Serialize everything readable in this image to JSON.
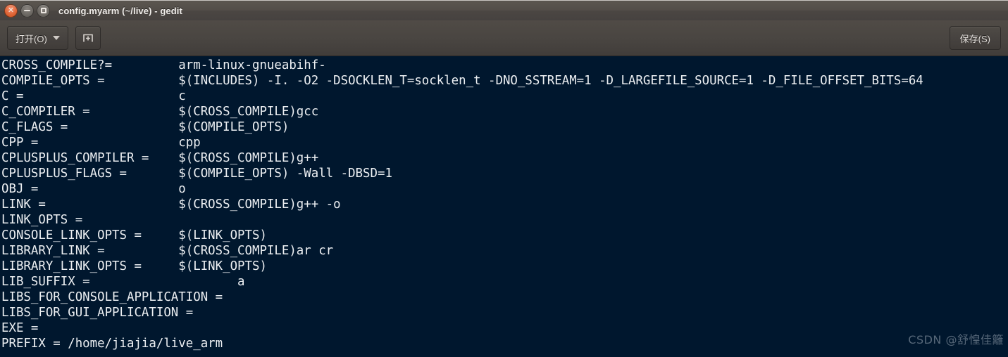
{
  "window": {
    "title": "config.myarm (~/live) - gedit",
    "controls": [
      {
        "name": "close",
        "label": "×"
      },
      {
        "name": "minimize",
        "label": "−"
      },
      {
        "name": "maximize",
        "label": "□"
      }
    ]
  },
  "toolbar": {
    "open_label": "打开(O)",
    "new_tab_icon": "new-document-icon",
    "save_label": "保存(S)"
  },
  "editor": {
    "filename": "config.myarm",
    "background_color": "#00172e",
    "text_color": "#eceff2",
    "cursor_line": 20,
    "lines": [
      "CROSS_COMPILE?=         arm-linux-gnueabihf-",
      "COMPILE_OPTS =          $(INCLUDES) -I. -O2 -DSOCKLEN_T=socklen_t -DNO_SSTREAM=1 -D_LARGEFILE_SOURCE=1 -D_FILE_OFFSET_BITS=64",
      "C =                     c",
      "C_COMPILER =            $(CROSS_COMPILE)gcc",
      "C_FLAGS =               $(COMPILE_OPTS)",
      "CPP =                   cpp",
      "CPLUSPLUS_COMPILER =    $(CROSS_COMPILE)g++",
      "CPLUSPLUS_FLAGS =       $(COMPILE_OPTS) -Wall -DBSD=1",
      "OBJ =                   o",
      "LINK =                  $(CROSS_COMPILE)g++ -o",
      "LINK_OPTS =",
      "CONSOLE_LINK_OPTS =     $(LINK_OPTS)",
      "LIBRARY_LINK =          $(CROSS_COMPILE)ar cr",
      "LIBRARY_LINK_OPTS =     $(LINK_OPTS)",
      "LIB_SUFFIX =                    a",
      "LIBS_FOR_CONSOLE_APPLICATION =",
      "LIBS_FOR_GUI_APPLICATION =",
      "EXE =",
      "PREFIX = /home/jiajia/live_arm"
    ]
  },
  "watermark": {
    "text": "CSDN @舒惶佳籬"
  }
}
